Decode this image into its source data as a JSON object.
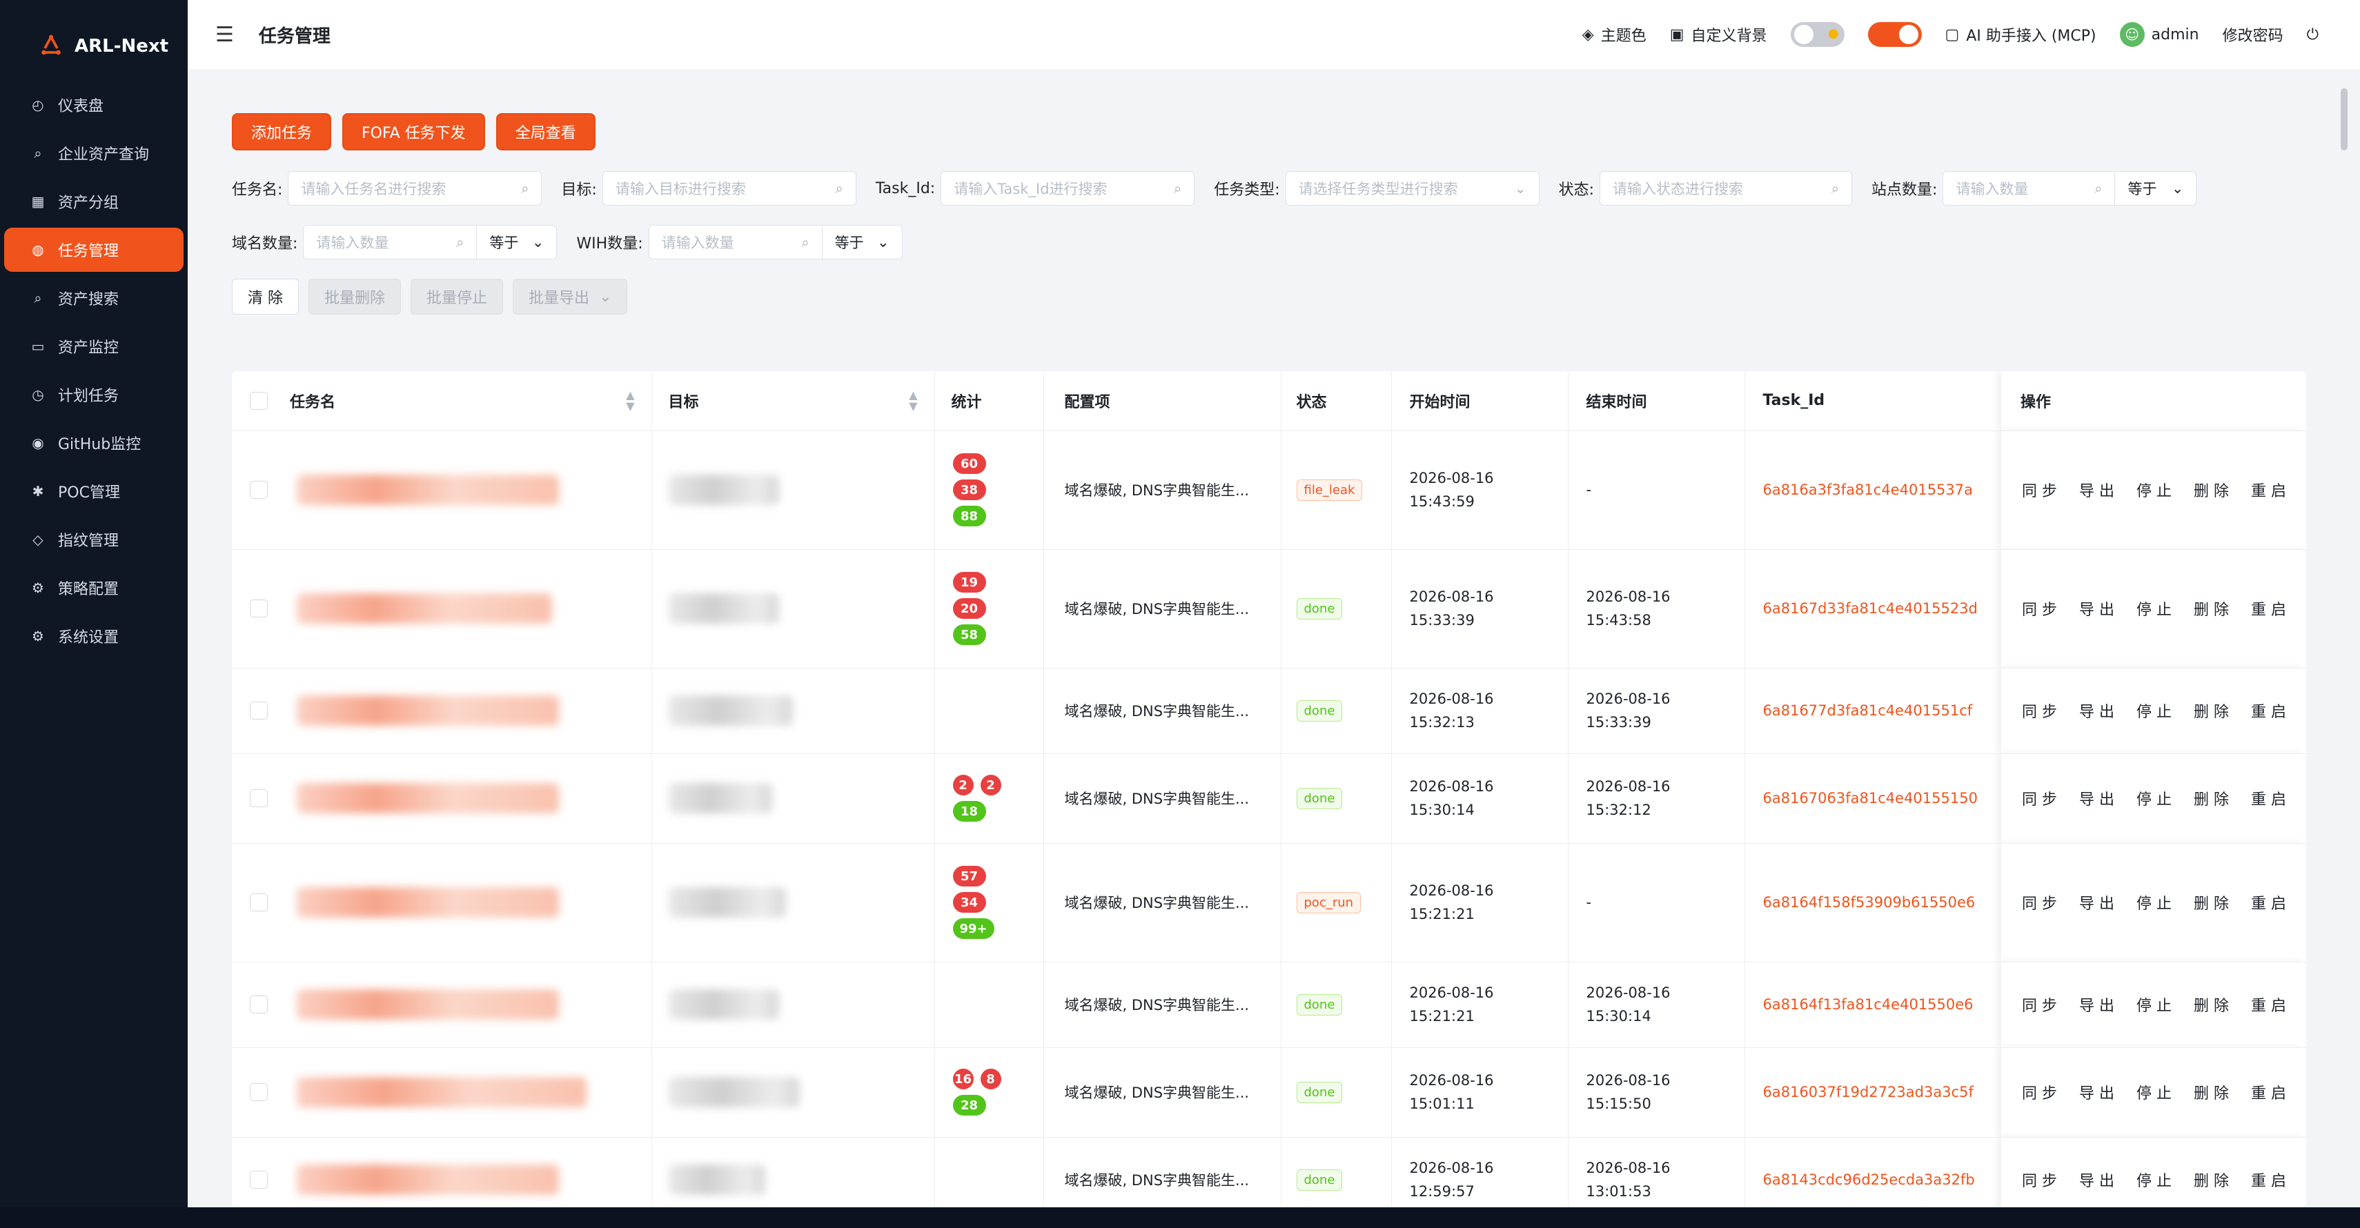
{
  "app": {
    "name": "ARL-Next"
  },
  "sidebar": {
    "items": [
      {
        "label": "仪表盘",
        "icon": "dashboard-icon"
      },
      {
        "label": "企业资产查询",
        "icon": "search-icon"
      },
      {
        "label": "资产分组",
        "icon": "grid-icon"
      },
      {
        "label": "任务管理",
        "icon": "globe-icon",
        "active": true
      },
      {
        "label": "资产搜索",
        "icon": "search-icon"
      },
      {
        "label": "资产监控",
        "icon": "monitor-icon"
      },
      {
        "label": "计划任务",
        "icon": "clock-icon"
      },
      {
        "label": "GitHub监控",
        "icon": "github-icon"
      },
      {
        "label": "POC管理",
        "icon": "bug-icon"
      },
      {
        "label": "指纹管理",
        "icon": "tag-icon"
      },
      {
        "label": "策略配置",
        "icon": "gear-icon"
      },
      {
        "label": "系统设置",
        "icon": "gear-icon"
      }
    ]
  },
  "header": {
    "title": "任务管理",
    "theme": "主题色",
    "bg": "自定义背景",
    "ai": "AI 助手接入 (MCP)",
    "user": "admin",
    "pwd": "修改密码"
  },
  "actions": {
    "add": "添加任务",
    "fofa": "FOFA 任务下发",
    "global": "全局查看"
  },
  "filters": {
    "name_label": "任务名:",
    "name_ph": "请输入任务名进行搜索",
    "target_label": "目标:",
    "target_ph": "请输入目标进行搜索",
    "taskid_label": "Task_Id:",
    "taskid_ph": "请输入Task_Id进行搜索",
    "type_label": "任务类型:",
    "type_ph": "请选择任务类型进行搜索",
    "status_label": "状态:",
    "status_ph": "请输入状态进行搜索",
    "site_label": "站点数量:",
    "site_ph": "请输入数量",
    "site_op": "等于",
    "domain_label": "域名数量:",
    "domain_ph": "请输入数量",
    "domain_op": "等于",
    "wih_label": "WIH数量:",
    "wih_ph": "请输入数量",
    "wih_op": "等于"
  },
  "bulk": {
    "clear": "清 除",
    "delete": "批量删除",
    "stop": "批量停止",
    "export": "批量导出"
  },
  "table": {
    "columns": [
      "任务名",
      "目标",
      "统计",
      "配置项",
      "状态",
      "开始时间",
      "结束时间",
      "Task_Id",
      "操作"
    ],
    "ops": [
      "同 步",
      "导 出",
      "停 止",
      "删 除",
      "重 启"
    ],
    "rows": [
      {
        "badges": [
          [
            "60"
          ],
          [
            "38"
          ]
        ],
        "green": "88",
        "config": "域名爆破, DNS字典智能生...",
        "status": "file_leak",
        "status_type": "warn",
        "start": [
          "2026-08-16",
          "15:43:59"
        ],
        "end": [
          "-"
        ],
        "task_id": "6a816a3f3fa81c4e4015537a"
      },
      {
        "badges": [
          [
            "19"
          ],
          [
            "20"
          ]
        ],
        "green": "58",
        "config": "域名爆破, DNS字典智能生...",
        "status": "done",
        "status_type": "done",
        "start": [
          "2026-08-16",
          "15:33:39"
        ],
        "end": [
          "2026-08-16",
          "15:43:58"
        ],
        "task_id": "6a8167d33fa81c4e4015523d"
      },
      {
        "badges": [],
        "green": "",
        "config": "域名爆破, DNS字典智能生...",
        "status": "done",
        "status_type": "done",
        "start": [
          "2026-08-16",
          "15:32:13"
        ],
        "end": [
          "2026-08-16",
          "15:33:39"
        ],
        "task_id": "6a81677d3fa81c4e401551cf"
      },
      {
        "badges": [
          [
            "2",
            "2"
          ]
        ],
        "green": "18",
        "config": "域名爆破, DNS字典智能生...",
        "status": "done",
        "status_type": "done",
        "start": [
          "2026-08-16",
          "15:30:14"
        ],
        "end": [
          "2026-08-16",
          "15:32:12"
        ],
        "task_id": "6a8167063fa81c4e40155150"
      },
      {
        "badges": [
          [
            "57"
          ],
          [
            "34"
          ]
        ],
        "green": "99+",
        "config": "域名爆破, DNS字典智能生...",
        "status": "poc_run",
        "status_type": "warn",
        "start": [
          "2026-08-16",
          "15:21:21"
        ],
        "end": [
          "-"
        ],
        "task_id": "6a8164f158f53909b61550e6"
      },
      {
        "badges": [],
        "green": "",
        "config": "域名爆破, DNS字典智能生...",
        "status": "done",
        "status_type": "done",
        "start": [
          "2026-08-16",
          "15:21:21"
        ],
        "end": [
          "2026-08-16",
          "15:30:14"
        ],
        "task_id": "6a8164f13fa81c4e401550e6"
      },
      {
        "badges": [
          [
            "16",
            "8"
          ]
        ],
        "green": "28",
        "config": "域名爆破, DNS字典智能生...",
        "status": "done",
        "status_type": "done",
        "start": [
          "2026-08-16",
          "15:01:11"
        ],
        "end": [
          "2026-08-16",
          "15:15:50"
        ],
        "task_id": "6a816037f19d2723ad3a3c5f"
      },
      {
        "badges": [],
        "green": "",
        "config": "域名爆破, DNS字典智能生...",
        "status": "done",
        "status_type": "done",
        "start": [
          "2026-08-16",
          "12:59:57"
        ],
        "end": [
          "2026-08-16",
          "13:01:53"
        ],
        "task_id": "6a8143cdc96d25ecda3a32fb"
      }
    ]
  }
}
